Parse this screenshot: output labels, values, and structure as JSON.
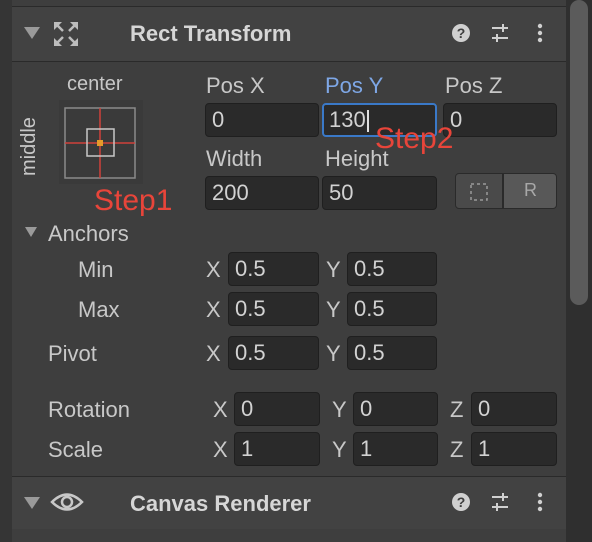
{
  "rect_transform": {
    "title": "Rect Transform",
    "anchor_preset": {
      "horizontal": "center",
      "vertical": "middle"
    },
    "labels": {
      "pos_x": "Pos X",
      "pos_y": "Pos Y",
      "pos_z": "Pos Z",
      "width": "Width",
      "height": "Height"
    },
    "values": {
      "pos_x": "0",
      "pos_y": "130",
      "pos_z": "0",
      "width": "200",
      "height": "50"
    },
    "raw_edit_label": "R",
    "anchors": {
      "label": "Anchors",
      "min_label": "Min",
      "max_label": "Max",
      "min": {
        "x": "0.5",
        "y": "0.5"
      },
      "max": {
        "x": "0.5",
        "y": "0.5"
      }
    },
    "pivot": {
      "label": "Pivot",
      "x": "0.5",
      "y": "0.5"
    },
    "rotation": {
      "label": "Rotation",
      "x": "0",
      "y": "0",
      "z": "0"
    },
    "scale": {
      "label": "Scale",
      "x": "1",
      "y": "1",
      "z": "1"
    },
    "axis_labels": {
      "x": "X",
      "y": "Y",
      "z": "Z"
    }
  },
  "annotations": {
    "step1": "Step1",
    "step2": "Step2"
  },
  "canvas_renderer": {
    "title": "Canvas Renderer"
  },
  "colors": {
    "annotation_red": "#e8453a",
    "active_field_border": "#3a79c8",
    "highlight_label": "#7ea7e6"
  },
  "icons": [
    "transform-icon",
    "help-icon",
    "presets-icon",
    "kebab-menu-icon",
    "eye-icon",
    "foldout-arrow-icon"
  ]
}
